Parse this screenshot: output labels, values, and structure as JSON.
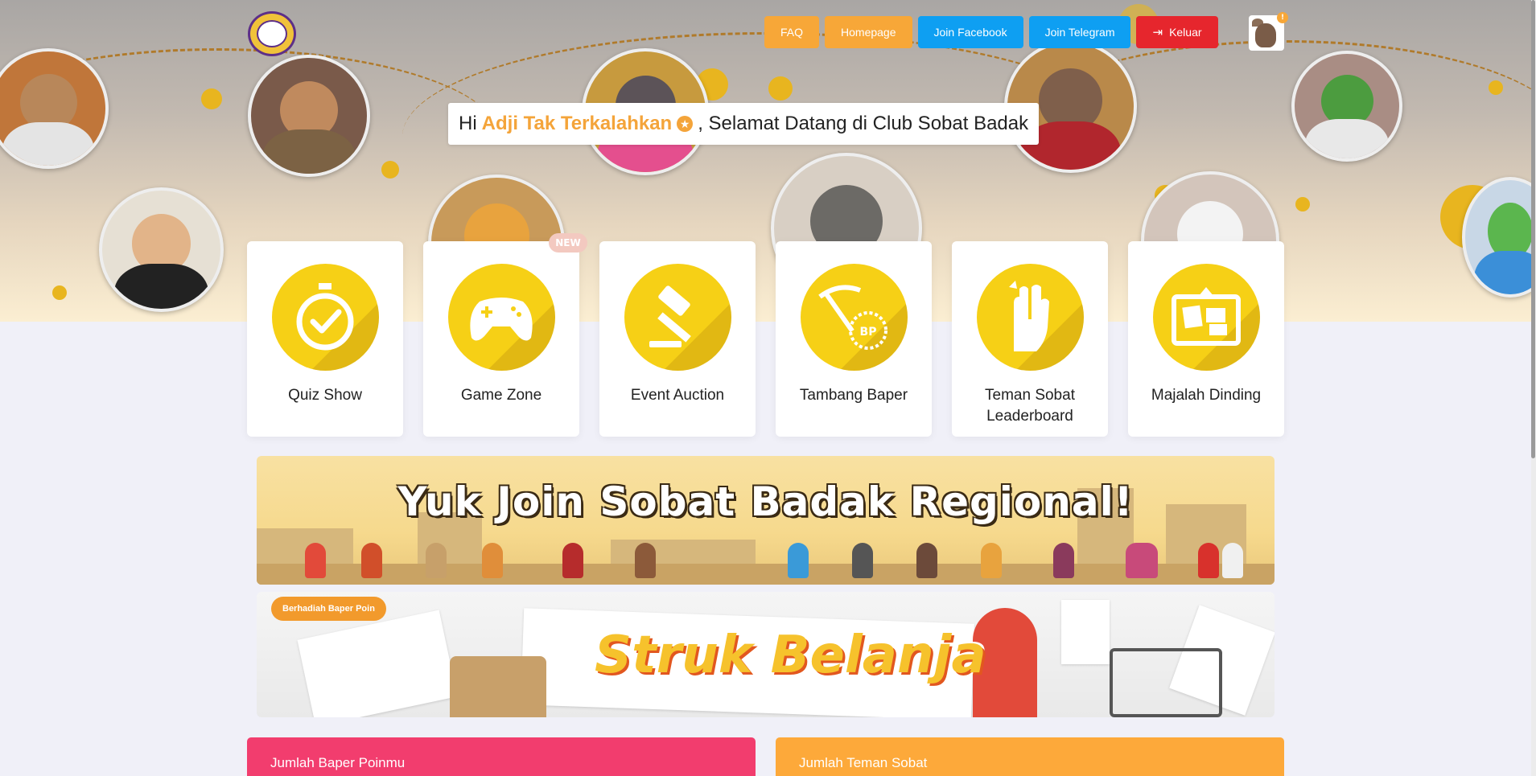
{
  "nav": {
    "faq": "FAQ",
    "homepage": "Homepage",
    "join_facebook": "Join Facebook",
    "join_telegram": "Join Telegram",
    "logout": "Keluar",
    "notification_count": "!"
  },
  "greeting": {
    "prefix": "Hi",
    "name": "Adji Tak Terkalahkan",
    "suffix": ", Selamat Datang di Club Sobat Badak"
  },
  "menu": [
    {
      "label": "Quiz Show",
      "icon": "stopwatch-icon"
    },
    {
      "label": "Game Zone",
      "icon": "gamepad-icon"
    },
    {
      "label": "Event Auction",
      "icon": "gavel-icon"
    },
    {
      "label": "Tambang Baper",
      "icon": "pickaxe-coin-icon"
    },
    {
      "label": "Teman Sobat Leaderboard",
      "icon": "high-five-icon"
    },
    {
      "label": "Majalah Dinding",
      "icon": "notice-board-icon"
    }
  ],
  "new_badge": "NEW",
  "banners": {
    "regional": "Yuk Join Sobat Badak Regional!",
    "struk_tag": "Berhadiah Baper Poin",
    "struk_title": "Struk Belanja"
  },
  "stats": {
    "baper_poin": "Jumlah Baper Poinmu",
    "teman_sobat": "Jumlah Teman Sobat"
  },
  "colors": {
    "accent_yellow": "#f6d016",
    "orange": "#f7a738",
    "blue": "#0e9ff2",
    "red": "#e6262d",
    "pink": "#f23d6e"
  }
}
